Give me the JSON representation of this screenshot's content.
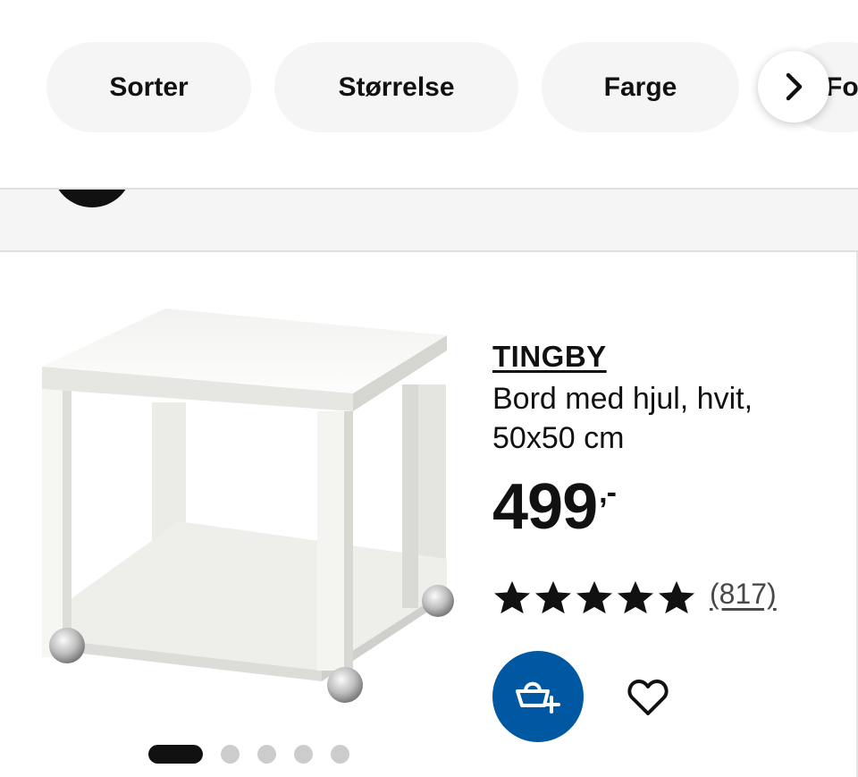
{
  "filters": {
    "chips": [
      {
        "label": "Sorter"
      },
      {
        "label": "Størrelse"
      },
      {
        "label": "Farge"
      }
    ],
    "partial_chip_label": "For",
    "scroll_icon": "chevron-right-icon"
  },
  "product": {
    "name": "TINGBY",
    "description": "Bord med hjul, hvit, 50x50 cm",
    "price": "499",
    "price_suffix": ",-",
    "rating": {
      "stars": 5,
      "review_count": "(817)"
    },
    "image_index": 1,
    "image_count": 5
  },
  "actions": {
    "cart_icon": "add-to-cart-icon",
    "favourite_icon": "heart-icon"
  },
  "colors": {
    "chip_bg": "#f5f5f5",
    "accent_blue": "#0058a3",
    "text": "#111111"
  }
}
